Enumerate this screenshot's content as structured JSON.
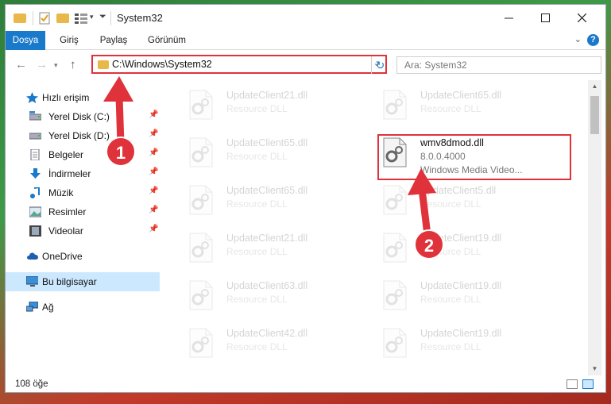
{
  "window": {
    "title": "System32"
  },
  "ribbon": {
    "tabs": [
      "Dosya",
      "Giriş",
      "Paylaş",
      "Görünüm"
    ]
  },
  "address": {
    "path": "C:\\Windows\\System32"
  },
  "search": {
    "placeholder": "Ara: System32"
  },
  "sidebar": {
    "items": [
      {
        "label": "Hızlı erişim",
        "icon": "star-icon",
        "pinned": false
      },
      {
        "label": "Yerel Disk (C:)",
        "icon": "drive-icon",
        "pinned": true
      },
      {
        "label": "Yerel Disk (D:)",
        "icon": "drive-icon",
        "pinned": true
      },
      {
        "label": "Belgeler",
        "icon": "documents-icon",
        "pinned": true
      },
      {
        "label": "İndirmeler",
        "icon": "download-icon",
        "pinned": true
      },
      {
        "label": "Müzik",
        "icon": "music-icon",
        "pinned": true
      },
      {
        "label": "Resimler",
        "icon": "pictures-icon",
        "pinned": true
      },
      {
        "label": "Videolar",
        "icon": "videos-icon",
        "pinned": true
      },
      {
        "label": "OneDrive",
        "icon": "cloud-icon",
        "pinned": false
      },
      {
        "label": "Bu bilgisayar",
        "icon": "computer-icon",
        "pinned": false
      },
      {
        "label": "Ağ",
        "icon": "network-icon",
        "pinned": false
      }
    ]
  },
  "files": {
    "left": [
      {
        "name": "UpdateClient21.dll",
        "desc": "Resource DLL"
      },
      {
        "name": "UpdateClient65.dll",
        "desc": "Resource DLL"
      },
      {
        "name": "UpdateClient65.dll",
        "desc": "Resource DLL"
      },
      {
        "name": "UpdateClient21.dll",
        "desc": "Resource DLL"
      },
      {
        "name": "UpdateClient63.dll",
        "desc": "Resource DLL"
      },
      {
        "name": "UpdateClient42.dll",
        "desc": "Resource DLL"
      }
    ],
    "right": [
      {
        "name": "UpdateClient65.dll",
        "desc": "Resource DLL"
      },
      {
        "name": "UpdateClient5.dll",
        "desc": "Resource DLL"
      },
      {
        "name": "UpdateClient19.dll",
        "desc": "Resource DLL"
      },
      {
        "name": "UpdateClient19.dll",
        "desc": "Resource DLL"
      },
      {
        "name": "UpdateClient19.dll",
        "desc": "Resource DLL"
      }
    ],
    "selected": {
      "name": "wmv8dmod.dll",
      "version": "8.0.0.4000",
      "desc": "Windows Media Video..."
    }
  },
  "status": {
    "count": "108 öğe"
  },
  "annotations": {
    "badge1": "1",
    "badge2": "2",
    "color": "#e0323a"
  }
}
